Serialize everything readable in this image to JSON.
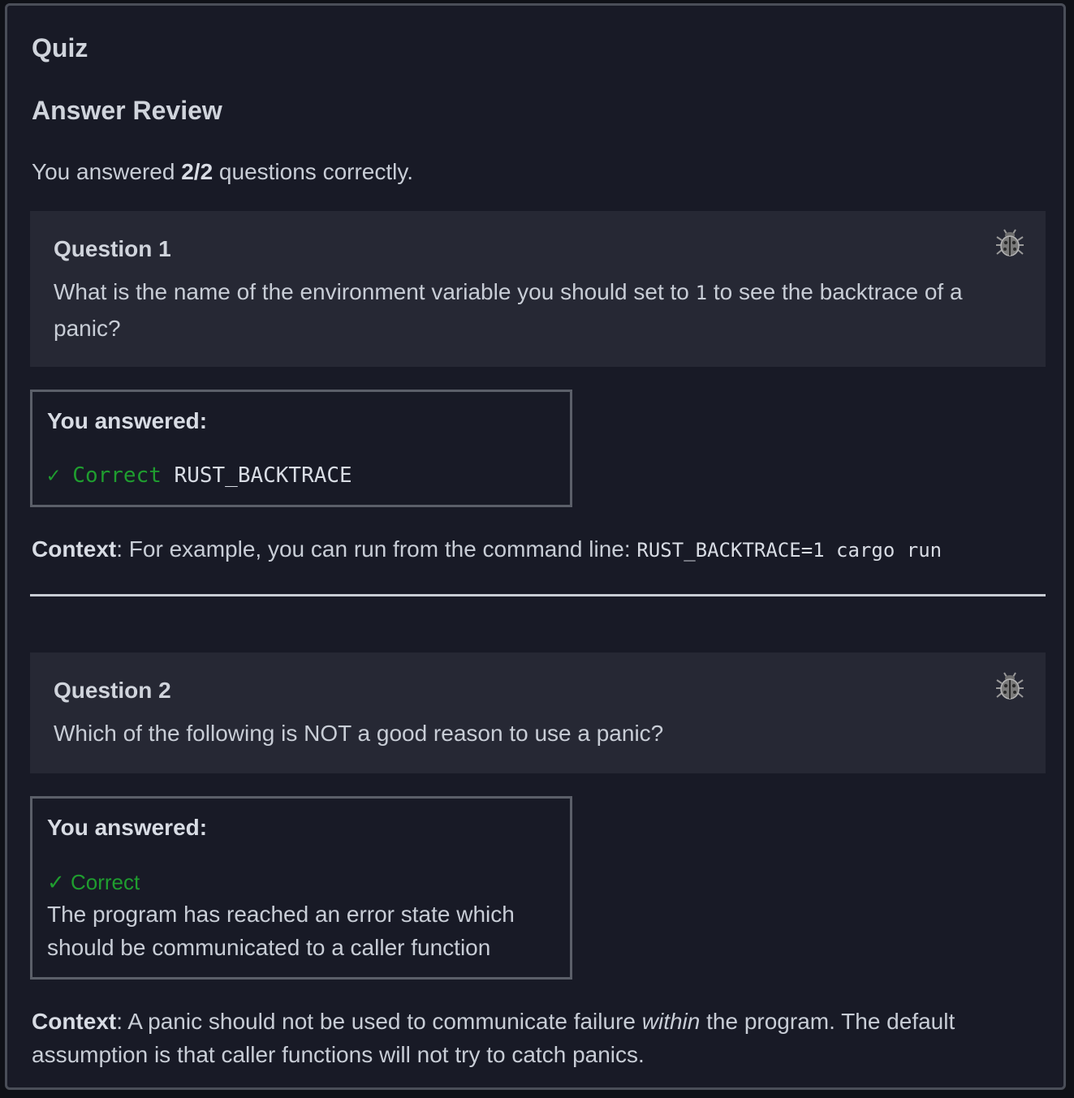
{
  "quiz": {
    "title": "Quiz",
    "subtitle": "Answer Review",
    "score_prefix": "You answered ",
    "score_value": "2/2",
    "score_suffix": " questions correctly."
  },
  "questions": [
    {
      "title": "Question 1",
      "text_before": "What is the name of the environment variable you should set to ",
      "text_code": "1",
      "text_after": " to see the backtrace of a panic?",
      "bug_icon": "bug-report-icon",
      "answer_label": "You answered:",
      "correct_label": "✓ Correct",
      "answer_value": "RUST_BACKTRACE",
      "context_label": "Context",
      "context_text": ": For example, you can run from the command line: ",
      "context_code": "RUST_BACKTRACE=1 cargo run"
    },
    {
      "title": "Question 2",
      "text": "Which of the following is NOT a good reason to use a panic?",
      "bug_icon": "bug-report-icon",
      "answer_label": "You answered:",
      "correct_label": "✓ Correct",
      "answer_value": "The program has reached an error state which should be communicated to a caller function",
      "context_label": "Context",
      "context_before": ": A panic should not be used to communicate failure ",
      "context_em": "within",
      "context_after": " the program. The default assumption is that caller functions will not try to catch panics."
    }
  ],
  "colors": {
    "background": "#181a26",
    "question_box": "#262834",
    "correct": "#1f9d2f"
  }
}
